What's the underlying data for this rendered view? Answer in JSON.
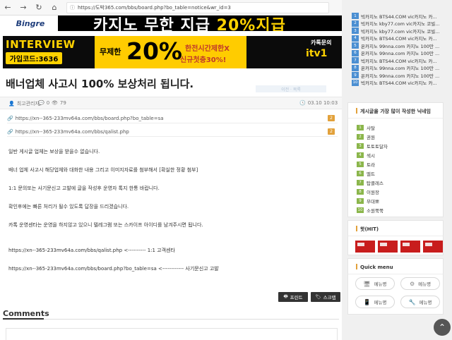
{
  "browser": {
    "url": "https://도박365.com/bbs/board.php?bo_table=notice&wr_id=3"
  },
  "banners": {
    "top_logo": "Bingre",
    "top_text": "카지노 무한 지급",
    "top_text_pct": "20%지급",
    "interview": "INTERVIEW",
    "signup_code": "가입코드:3636",
    "unlimited": "무제한",
    "percent": "20%",
    "line1": "한전시간제한X",
    "line2": "신규첫충30%!",
    "contact": "카톡문의",
    "brand": "itv1"
  },
  "post": {
    "title": "배너업체 사고시 100% 보상처리 됩니다.",
    "faint_tag": "이전 · 목록",
    "author": "최고관리자",
    "comments": "0",
    "views": "79",
    "date": "03.10 10:03",
    "links": [
      {
        "url": "https://xn--365-233mv64a.com/bbs/board.php?bo_table=sa",
        "count": "2"
      },
      {
        "url": "https://xn--365-233mv64a.com/bbs/qalist.php",
        "count": "2"
      }
    ],
    "body": [
      "일반 게시글 업체는 보상을 받을수 없습니다.",
      "배너 업체 사고시 해당업체와 대화한 내용 그리고 이미지자료를 첨부해서 [확실한 정황 첨부]",
      "1:1 문의또는 사기문신고 고발에 글을 작성후 운영자 톡지 한통 바랍니다.",
      "확인후에는 빠른 처리가 될수 있도록 답장을 드리겠습니다.",
      "카톡 운영센타는 운영을 하지않고 있으니 텔레그램 또는 스카이프 아이디를 남겨주시면 됩니다.",
      "https://xn--365-233mv64a.com/bbs/qalist.php   <---------- 1:1 고객센타",
      "https://xn--365-233mv64a.com/bbs/board.php?bo_table=sa   <------------ 사기문신고 고발"
    ],
    "print_label": "프린트",
    "scrap_label": "스크랩",
    "comments_title": "Comments"
  },
  "sidebar": {
    "ranking": [
      {
        "n": "1",
        "t": "빅카지노 BTS44.COM vic카지노 카..."
      },
      {
        "n": "2",
        "t": "빅카지노 kby77.com vic카지노 코빌..."
      },
      {
        "n": "3",
        "t": "빅카지노 kby77.com vic카지노 코빌..."
      },
      {
        "n": "4",
        "t": "빅카지노 BTS44.COM vic카지노 카..."
      },
      {
        "n": "5",
        "t": "온카지노 99nna.com 카지노 100만 ..."
      },
      {
        "n": "6",
        "t": "온카지노 99nna.com 카지노 100만 ..."
      },
      {
        "n": "7",
        "t": "빅카지노 BTS44.COM vic카지노 카..."
      },
      {
        "n": "8",
        "t": "온카지노 99nna.com 카지노 100만 ..."
      },
      {
        "n": "9",
        "t": "온카지노 99nna.com 카지노 100만 ..."
      },
      {
        "n": "10",
        "t": "빅카지노 BTS44.COM vic카지노 카..."
      }
    ],
    "writers_title": "게시글을 가장 많이 작성한 닉네임",
    "writers": [
      {
        "n": "1",
        "t": "사탈"
      },
      {
        "n": "2",
        "t": "권원"
      },
      {
        "n": "3",
        "t": "토토토달자"
      },
      {
        "n": "4",
        "t": "섹시"
      },
      {
        "n": "5",
        "t": "토라"
      },
      {
        "n": "6",
        "t": "멜트"
      },
      {
        "n": "7",
        "t": "탑클레스"
      },
      {
        "n": "8",
        "t": "이원장"
      },
      {
        "n": "9",
        "t": "무대뽀"
      },
      {
        "n": "10",
        "t": "소원쭉쭉"
      }
    ],
    "hit_title": "핫(HIT)",
    "quick_title": "Quick menu",
    "quick": [
      "메뉴명",
      "메뉴명",
      "메뉴명",
      "메뉴명"
    ]
  }
}
